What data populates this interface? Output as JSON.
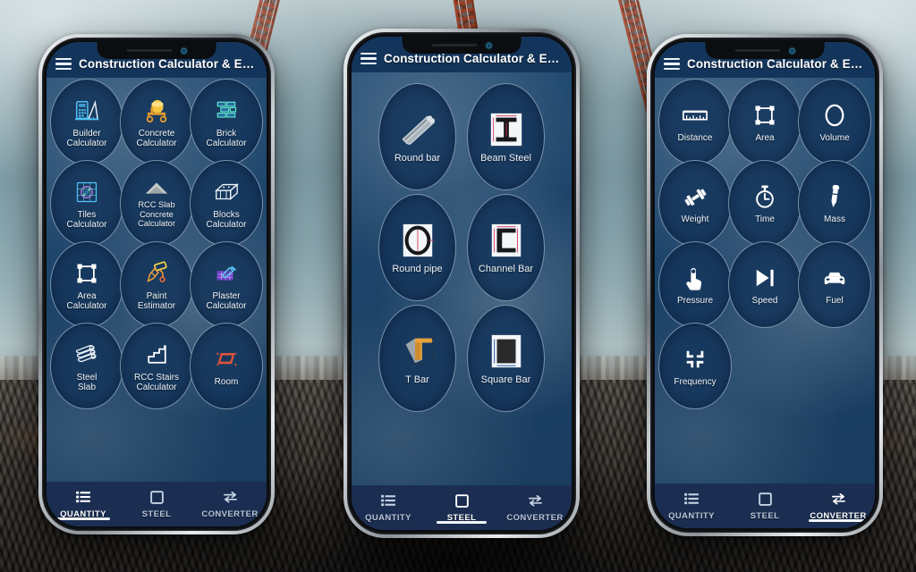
{
  "app": {
    "title": "Construction Calculator & Esti...",
    "menu_icon": "hamburger-menu-icon",
    "colors": {
      "appbar": "#14355b",
      "screen_bg": "#1d4168",
      "circle_bg": "#16375c",
      "circle_border": "#c8daeb",
      "nav_bg": "#1b2e52",
      "nav_active": "#ffffff",
      "nav_inactive": "#b9c6d8"
    }
  },
  "bottom_nav": {
    "items": [
      {
        "label": "QUANTITY",
        "icon": "list-icon"
      },
      {
        "label": "STEEL",
        "icon": "square-outline-icon"
      },
      {
        "label": "CONVERTER",
        "icon": "swap-arrows-icon"
      }
    ]
  },
  "phones": [
    {
      "name": "quantity-phone",
      "active_tab": "QUANTITY",
      "active_tab_index": 0,
      "grid_columns": 3,
      "items": [
        {
          "label": "Builder\nCalculator",
          "label_lines": [
            "Builder",
            "Calculator"
          ],
          "icon": "builder-calculator-icon"
        },
        {
          "label": "Concrete\nCalculator",
          "label_lines": [
            "Concrete",
            "Calculator"
          ],
          "icon": "concrete-mixer-icon"
        },
        {
          "label": "Brick\nCalculator",
          "label_lines": [
            "Brick",
            "Calculator"
          ],
          "icon": "brick-wall-icon"
        },
        {
          "label": "Tiles\nCalculator",
          "label_lines": [
            "Tiles",
            "Calculator"
          ],
          "icon": "tiles-icon"
        },
        {
          "label": "RCC Slab\nConcrete\nCalculator",
          "label_lines": [
            "RCC Slab",
            "Concrete",
            "Calculator"
          ],
          "icon": "slab-chevron-icon"
        },
        {
          "label": "Blocks\nCalculator",
          "label_lines": [
            "Blocks",
            "Calculator"
          ],
          "icon": "blocks-icon"
        },
        {
          "label": "Area\nCalculator",
          "label_lines": [
            "Area",
            "Calculator"
          ],
          "icon": "area-square-icon"
        },
        {
          "label": "Paint\nEstimator",
          "label_lines": [
            "Paint",
            "Estimator"
          ],
          "icon": "paint-roller-icon"
        },
        {
          "label": "Plaster\nCalculator",
          "label_lines": [
            "Plaster",
            "Calculator"
          ],
          "icon": "plaster-trowel-icon"
        },
        {
          "label": "Steel\nSlab",
          "label_lines": [
            "Steel",
            "Slab"
          ],
          "icon": "steel-pipes-icon"
        },
        {
          "label": "RCC Stairs\nCalculator",
          "label_lines": [
            "RCC Stairs",
            "Calculator"
          ],
          "icon": "stairs-icon"
        },
        {
          "label": "Room",
          "label_lines": [
            "Room"
          ],
          "icon": "room-icon"
        }
      ]
    },
    {
      "name": "steel-phone",
      "active_tab": "STEEL",
      "active_tab_index": 1,
      "grid_columns": 2,
      "items": [
        {
          "label": "Round bar",
          "label_lines": [
            "Round",
            "bar"
          ],
          "icon": "round-bar-icon"
        },
        {
          "label": "Beam Steel",
          "label_lines": [
            "Beam",
            "Steel"
          ],
          "icon": "i-beam-icon"
        },
        {
          "label": "Round pipe",
          "label_lines": [
            "Round",
            "pipe"
          ],
          "icon": "round-pipe-icon"
        },
        {
          "label": "Channel Bar",
          "label_lines": [
            "Channel",
            "Bar"
          ],
          "icon": "channel-bar-icon"
        },
        {
          "label": "T Bar",
          "label_lines": [
            "T Bar"
          ],
          "icon": "t-bar-icon"
        },
        {
          "label": "Square Bar",
          "label_lines": [
            "Square Bar"
          ],
          "icon": "square-bar-icon"
        }
      ]
    },
    {
      "name": "converter-phone",
      "active_tab": "CONVERTER",
      "active_tab_index": 2,
      "grid_columns": 3,
      "items": [
        {
          "label": "Distance",
          "label_lines": [
            "Distance"
          ],
          "icon": "ruler-icon"
        },
        {
          "label": "Area",
          "label_lines": [
            "Area"
          ],
          "icon": "area-square-icon"
        },
        {
          "label": "Volume",
          "label_lines": [
            "Volume"
          ],
          "icon": "circle-outline-icon"
        },
        {
          "label": "Weight",
          "label_lines": [
            "Weight"
          ],
          "icon": "dumbbell-icon"
        },
        {
          "label": "Time",
          "label_lines": [
            "Time"
          ],
          "icon": "stopwatch-icon"
        },
        {
          "label": "Mass",
          "label_lines": [
            "Mass"
          ],
          "icon": "dropper-icon"
        },
        {
          "label": "Pressure",
          "label_lines": [
            "Pressure"
          ],
          "icon": "tap-hand-icon"
        },
        {
          "label": "Speed",
          "label_lines": [
            "Speed"
          ],
          "icon": "speed-skip-icon"
        },
        {
          "label": "Fuel",
          "label_lines": [
            "Fuel"
          ],
          "icon": "car-icon"
        },
        {
          "label": "Frequency",
          "label_lines": [
            "Frequency"
          ],
          "icon": "collapse-arrows-icon"
        }
      ]
    }
  ],
  "background": {
    "scene": "construction-site-with-tower-cranes",
    "crane_count": 3
  }
}
